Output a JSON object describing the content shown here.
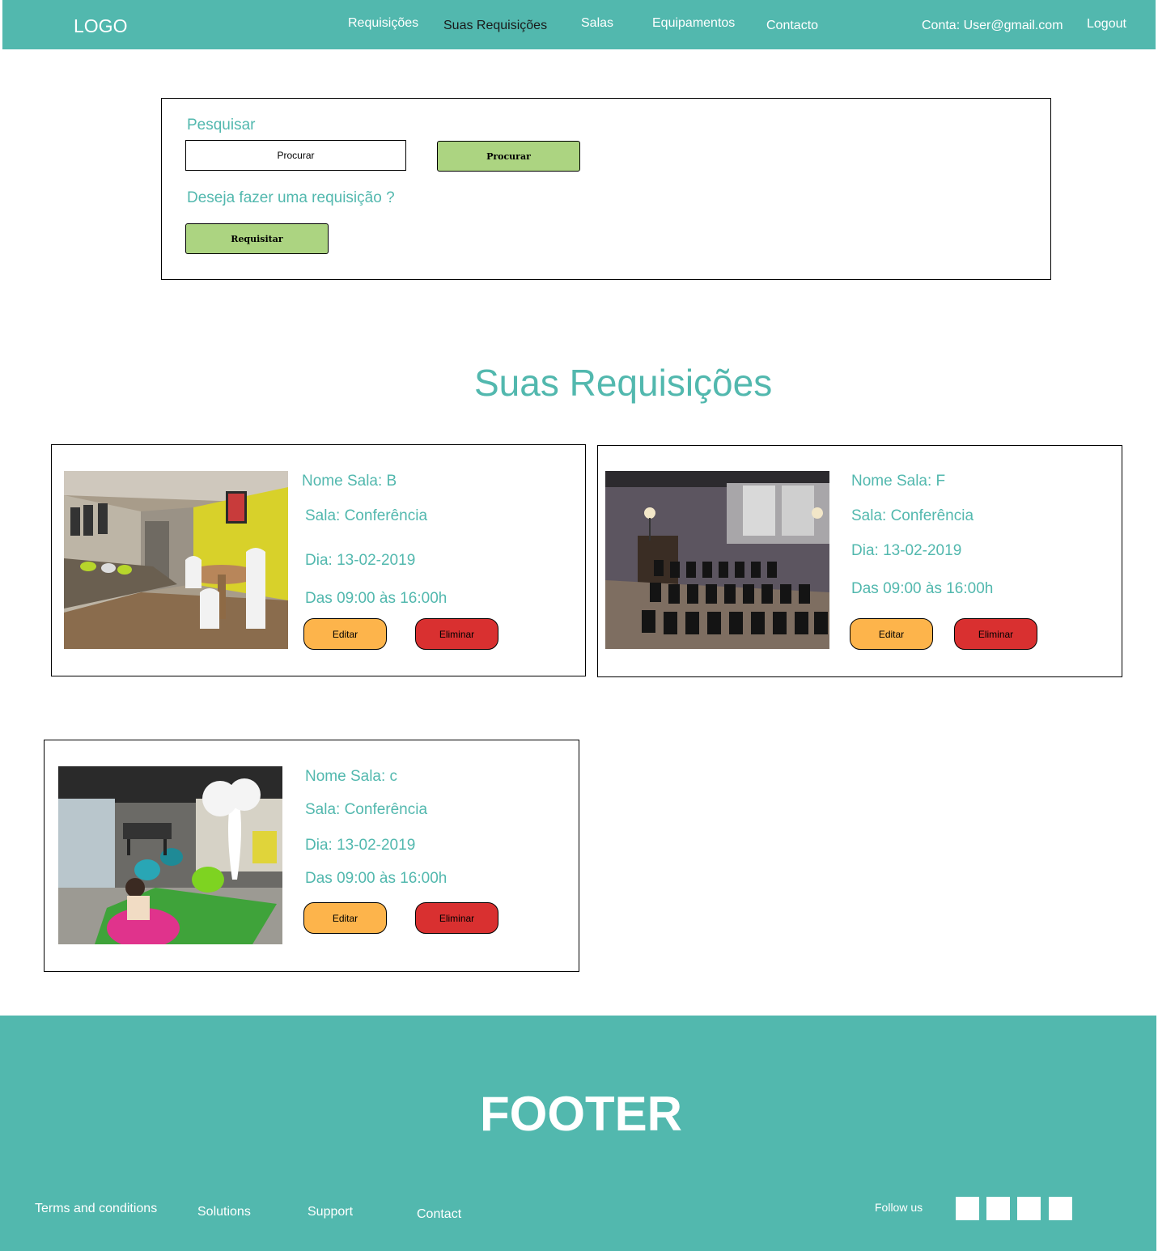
{
  "header": {
    "logo": "LOGO",
    "nav": [
      {
        "label": "Requisições"
      },
      {
        "label": "Suas Requisições"
      },
      {
        "label": "Salas"
      },
      {
        "label": "Equipamentos"
      },
      {
        "label": "Contacto"
      }
    ],
    "account": "Conta: User@gmail.com",
    "logout": "Logout"
  },
  "search": {
    "label": "Pesquisar",
    "placeholder": "Procurar",
    "button": "Procurar",
    "prompt": "Deseja fazer uma requisição ?",
    "request_button": "Requisitar"
  },
  "section_title": "Suas Requisições",
  "cards": [
    {
      "name": "Nome Sala: B",
      "type": "Sala: Conferência",
      "day": "Dia: 13-02-2019",
      "hours": "Das 09:00 às 16:00h",
      "edit": "Editar",
      "delete": "Eliminar",
      "image": "lounge-room-photo"
    },
    {
      "name": "Nome Sala: F",
      "type": "Sala: Conferência",
      "day": "Dia: 13-02-2019",
      "hours": "Das 09:00 às 16:00h",
      "edit": "Editar",
      "delete": "Eliminar",
      "image": "conference-room-photo"
    },
    {
      "name": "Nome Sala: c",
      "type": "Sala: Conferência",
      "day": "Dia: 13-02-2019",
      "hours": "Das 09:00 às 16:00h",
      "edit": "Editar",
      "delete": "Eliminar",
      "image": "open-office-photo"
    }
  ],
  "footer": {
    "title": "FOOTER",
    "links": [
      "Terms and conditions",
      "Solutions",
      "Support",
      "Contact"
    ],
    "follow": "Follow us",
    "social_icons": [
      "social-icon-1",
      "social-icon-2",
      "social-icon-3",
      "social-icon-4"
    ]
  },
  "colors": {
    "teal": "#52b8ae",
    "green_button": "#acd481",
    "edit_button": "#fdb44b",
    "delete_button": "#d93030"
  }
}
